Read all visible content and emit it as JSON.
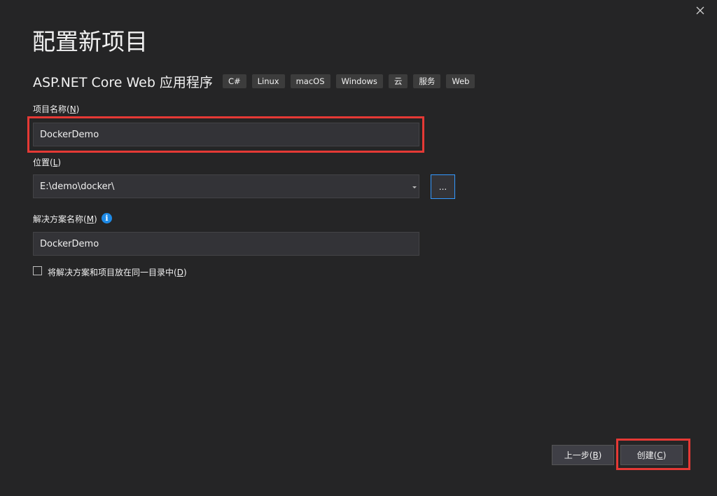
{
  "window": {
    "close_icon": "close-icon"
  },
  "page": {
    "title": "配置新项目"
  },
  "template": {
    "name": "ASP.NET Core Web 应用程序",
    "tags": [
      "C#",
      "Linux",
      "macOS",
      "Windows",
      "云",
      "服务",
      "Web"
    ]
  },
  "project_name": {
    "label": "项目名称(",
    "mnemonic": "N",
    "label_end": ")",
    "value": "DockerDemo"
  },
  "location": {
    "label": "位置(",
    "mnemonic": "L",
    "label_end": ")",
    "value": "E:\\demo\\docker\\",
    "browse_label": "..."
  },
  "solution_name": {
    "label": "解决方案名称(",
    "mnemonic": "M",
    "label_end": ")",
    "info_glyph": "i",
    "value": "DockerDemo"
  },
  "same_directory": {
    "label": "将解决方案和项目放在同一目录中(",
    "mnemonic": "D",
    "label_end": ")",
    "checked": false
  },
  "buttons": {
    "back": {
      "label": "上一步(",
      "mnemonic": "B",
      "label_end": ")"
    },
    "create": {
      "label": "创建(",
      "mnemonic": "C",
      "label_end": ")"
    }
  },
  "colors": {
    "background": "#252526",
    "input_background": "#333337",
    "highlight": "#e53935",
    "focus_border": "#3399ff",
    "info_icon": "#1e8ae6"
  }
}
